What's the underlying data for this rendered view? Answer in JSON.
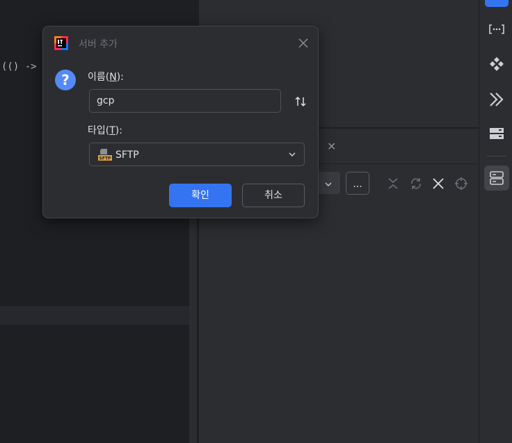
{
  "editor": {
    "code_fragment": "(() ->"
  },
  "toolwindow": {
    "tab_close_glyph": "✕",
    "combo_arrow_glyph": "⌄",
    "more_button_label": "..."
  },
  "dialog": {
    "title": "서버 추가",
    "name_label": {
      "before": "이름(",
      "mnemonic": "N",
      "after": "):"
    },
    "name_value": "gcp",
    "type_label": {
      "before": "타입(",
      "mnemonic": "T",
      "after": "):"
    },
    "type_value": "SFTP",
    "ok_label": "확인",
    "cancel_label": "취소"
  },
  "icons": {
    "app": "intellij-logo-icon",
    "close": "close-icon",
    "question": "question-icon",
    "swap": "swap-arrows-icon",
    "sftp": "sftp-icon",
    "chevron": "chevron-down-icon",
    "toolbar": [
      "collapse-icon",
      "refresh-icon",
      "close-icon",
      "crosshair-icon"
    ],
    "stripe": [
      "structure-icon",
      "bracket-icon",
      "plugins-icon",
      "run-icon",
      "database-icon",
      "remote-hosts-icon"
    ]
  },
  "colors": {
    "accent": "#3574f0",
    "question": "#548af7",
    "background": "#2b2d30",
    "editor": "#1e1f22"
  }
}
